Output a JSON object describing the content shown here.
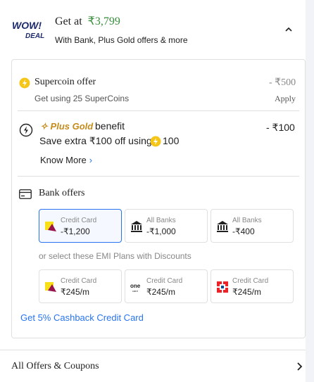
{
  "header": {
    "logo_text_top": "WOW!",
    "logo_text_bottom": "DEAL",
    "get_at_label": "Get at",
    "price": "₹3,799",
    "subtitle": "With Bank, Plus Gold offers & more",
    "collapse_icon": "chevron-up-icon"
  },
  "supercoin": {
    "title": "Supercoin offer",
    "value": "- ₹500",
    "subtitle": "Get using 25 SuperCoins",
    "apply_label": "Apply",
    "icon": "supercoin-icon"
  },
  "plus_gold": {
    "brand": "Plus Gold",
    "benefit": "benefit",
    "value": "- ₹100",
    "save_text": "Save extra ₹100 off using",
    "coin_amount": "100",
    "know_more": "Know More",
    "icon": "lightning-circle-icon"
  },
  "bank_offers": {
    "title": "Bank offers",
    "icon": "card-icon",
    "tiles": [
      {
        "label": "Credit Card",
        "value": "-₹1,200",
        "icon": "flipkart-axis-icon"
      },
      {
        "label": "All Banks",
        "value": "-₹1,000",
        "icon": "bank-icon"
      },
      {
        "label": "All Banks",
        "value": "-₹400",
        "icon": "bank-icon"
      }
    ],
    "emi_caption": "or select these EMI Plans with Discounts",
    "emi_tiles": [
      {
        "label": "Credit Card",
        "value": "₹245/m",
        "icon": "flipkart-axis-icon"
      },
      {
        "label": "Credit Card",
        "value": "₹245/m",
        "icon": "onecard-icon"
      },
      {
        "label": "Credit Card",
        "value": "₹245/m",
        "icon": "hdfc-icon"
      }
    ],
    "cashback_link": "Get 5% Cashback Credit Card"
  },
  "footer": {
    "all_offers_label": "All Offers & Coupons",
    "chevron_icon": "chevron-right-icon"
  },
  "colors": {
    "price_green": "#388e3c",
    "link_blue": "#2874f0",
    "gold": "#c58b1b",
    "supercoin_yellow": "#f5c518"
  }
}
